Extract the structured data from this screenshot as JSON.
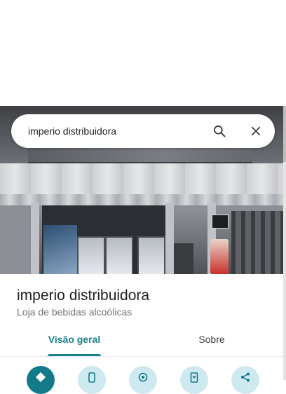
{
  "search": {
    "query": "imperio distribuidora",
    "search_icon": "search-icon",
    "close_icon": "close-icon"
  },
  "place": {
    "name": "imperio distribuidora",
    "category": "Loja de bebidas alcoólicas"
  },
  "tabs": [
    {
      "label": "Visão geral",
      "selected": true
    },
    {
      "label": "Sobre",
      "selected": false
    }
  ],
  "actions": [
    {
      "icon": "directions-icon",
      "primary": true
    },
    {
      "icon": "phone-icon",
      "primary": false
    },
    {
      "icon": "location-icon",
      "primary": false
    },
    {
      "icon": "save-icon",
      "primary": false
    },
    {
      "icon": "share-icon",
      "primary": false
    }
  ],
  "colors": {
    "accent": "#1a7f8e",
    "primary_action": "#137a8a",
    "action_bg": "#cfe9f0",
    "title_text": "#202124",
    "secondary_text": "#70757a"
  }
}
